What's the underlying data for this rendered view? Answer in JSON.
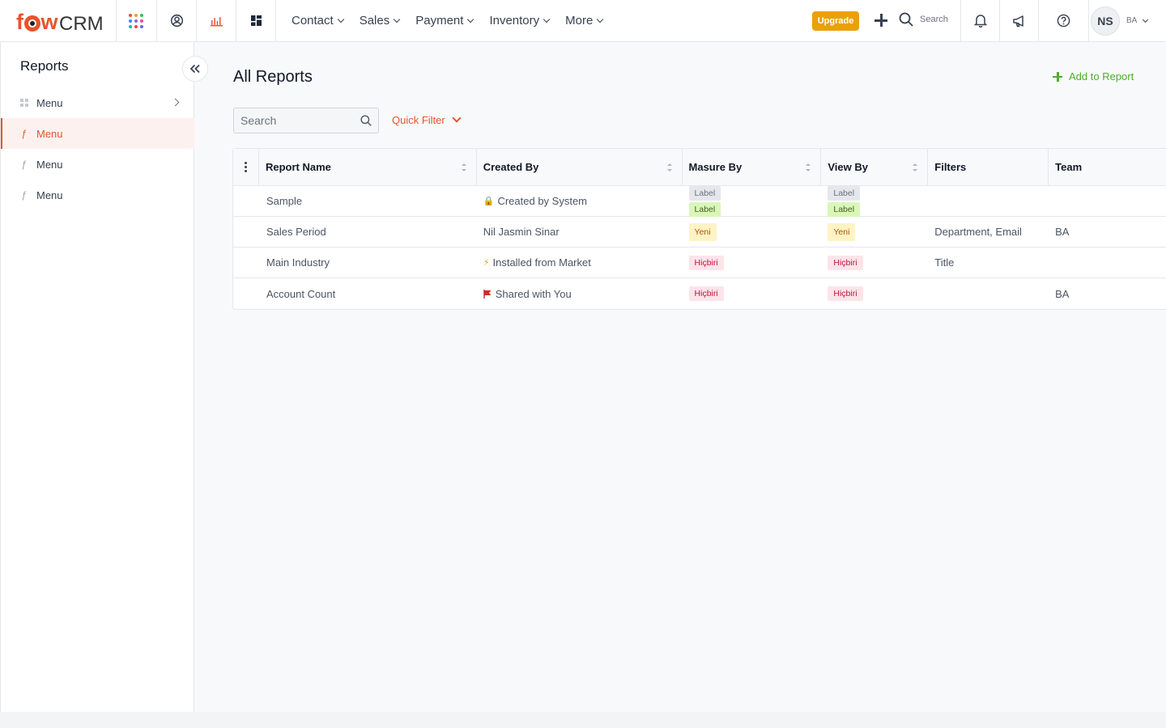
{
  "brand": {
    "logo_prefix": "f",
    "logo_w": "w",
    "logo_crm": "CRM",
    "accent": "#e8542a"
  },
  "topnav": {
    "items": [
      {
        "label": "Contact"
      },
      {
        "label": "Sales"
      },
      {
        "label": "Payment"
      },
      {
        "label": "Inventory"
      },
      {
        "label": "More"
      }
    ],
    "upgrade_label": "Upgrade",
    "search_label": "Search",
    "user_initials": "NS",
    "user_team": "BA"
  },
  "sidebar": {
    "title": "Reports",
    "items": [
      {
        "label": "Menu"
      },
      {
        "label": "Menu"
      },
      {
        "label": "Menu"
      },
      {
        "label": "Menu"
      }
    ]
  },
  "main": {
    "title": "All Reports",
    "add_label": "Add to Report",
    "search_placeholder": "Search",
    "quick_filter_label": "Quick Filter"
  },
  "table": {
    "columns": [
      "Report Name",
      "Created By",
      "Masure By",
      "View By",
      "Filters",
      "Team"
    ],
    "rows": [
      {
        "name": "Sample",
        "created_icon": "lock-icon",
        "created_by": "Created by System",
        "measure": [
          "Label",
          "Label"
        ],
        "view": [
          "Label",
          "Label"
        ],
        "filters": "",
        "team": ""
      },
      {
        "name": "Sales Period",
        "created_icon": "",
        "created_by": "Nil Jasmin Sinar",
        "measure": [
          "Yeni"
        ],
        "view": [
          "Yeni"
        ],
        "filters": "Department, Email",
        "team": "BA"
      },
      {
        "name": "Main Industry",
        "created_icon": "lightning-icon",
        "created_by": "Installed from Market",
        "measure": [
          "Hiçbiri"
        ],
        "view": [
          "Hiçbiri"
        ],
        "filters": "Title",
        "team": ""
      },
      {
        "name": "Account Count",
        "created_icon": "flag-icon",
        "created_by": "Shared with You",
        "measure": [
          "Hiçbiri"
        ],
        "view": [
          "Hiçbiri"
        ],
        "filters": "",
        "team": "BA"
      }
    ]
  }
}
